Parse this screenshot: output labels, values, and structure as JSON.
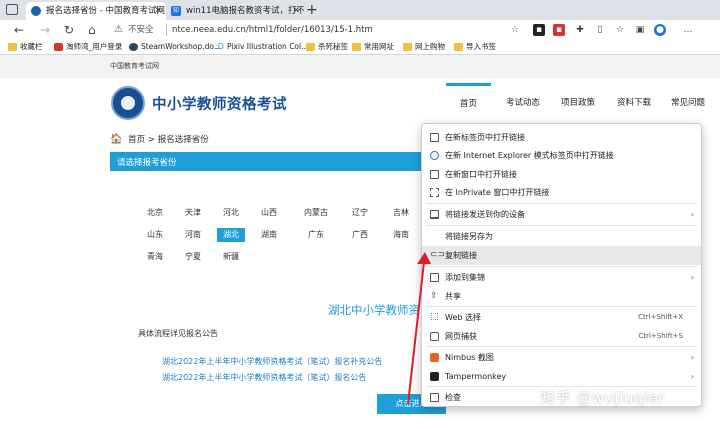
{
  "browser": {
    "tabs": [
      {
        "title": "报名选择省份 - 中国教育考试网",
        "icon": "neea-favicon",
        "active": true
      },
      {
        "title": "win11电脑报名教资考试，打不开...",
        "icon": "zhihu-favicon",
        "favicon_text": "知",
        "active": false
      }
    ],
    "new_tab": "+",
    "address": {
      "security_label": "不安全",
      "url": "ntce.neea.edu.cn/html1/folder/16013/15-1.htm"
    },
    "bookmarks": [
      {
        "label": "收藏栏",
        "icon": "folder-icon"
      },
      {
        "label": "淘师湾_用户登录",
        "icon": "red-site-icon"
      },
      {
        "label": "SteamWorkshop.do...",
        "icon": "steam-icon"
      },
      {
        "label": "Pixiv Illustration Col...",
        "icon": "pixiv-icon"
      },
      {
        "label": "杀死秘签",
        "icon": "folder-icon"
      },
      {
        "label": "常用网址",
        "icon": "folder-icon"
      },
      {
        "label": "网上购物",
        "icon": "folder-icon"
      },
      {
        "label": "导入书签",
        "icon": "folder-icon"
      }
    ]
  },
  "site": {
    "top_label": "中国教育考试网",
    "name": "中小学教师资格考试",
    "nav": [
      "首页",
      "考试动态",
      "项目政策",
      "资料下载",
      "常见问题"
    ],
    "breadcrumb": {
      "home": "首页",
      "separator": ">",
      "current": "报名选择省份"
    },
    "section_title": "请选择报考省份",
    "provinces": [
      [
        "北京",
        "天津",
        "河北",
        "山西",
        "内蒙古",
        "辽宁",
        "吉林"
      ],
      [
        "山东",
        "河南",
        "湖北",
        "湖南",
        "广东",
        "广西",
        "海南"
      ],
      [
        "青海",
        "宁夏",
        "新疆"
      ]
    ],
    "selected_province": "湖北",
    "exam_title": "湖北中小学教师资",
    "flow_label": "具体流程详见报名公告",
    "notices": [
      "湖北2022年上半年中小学教师资格考试（笔试）报名补充公告",
      "湖北2022年上半年中小学教师资格考试（笔试）报名公告"
    ],
    "apply_button": "点击进入"
  },
  "context_menu": {
    "items": [
      {
        "label": "在新标签页中打开链接",
        "icon": "new-tab-icon"
      },
      {
        "label": "在新 Internet Explorer 模式标签页中打开链接",
        "icon": "ie-icon"
      },
      {
        "label": "在新窗口中打开链接",
        "icon": "new-window-icon"
      },
      {
        "label": "在 InPrivate 窗口中打开链接",
        "icon": "inprivate-icon"
      },
      {
        "label": "将链接发送到你的设备",
        "icon": "send-device-icon",
        "submenu": true
      },
      {
        "label": "将链接另存为",
        "icon": ""
      },
      {
        "label": "复制链接",
        "icon": "link-icon",
        "highlighted": true
      },
      {
        "label": "添加到集锦",
        "icon": "collections-icon",
        "submenu": true
      },
      {
        "label": "共享",
        "icon": "share-icon"
      },
      {
        "label": "Web 选择",
        "icon": "web-select-icon",
        "shortcut": "Ctrl+Shift+X"
      },
      {
        "label": "网页捕获",
        "icon": "web-capture-icon",
        "shortcut": "Ctrl+Shift+S"
      },
      {
        "label": "Nimbus 截图",
        "icon": "nimbus-icon",
        "submenu": true
      },
      {
        "label": "Tampermonkey",
        "icon": "tampermonkey-icon",
        "submenu": true
      },
      {
        "label": "检查",
        "icon": "inspect-icon"
      }
    ]
  },
  "watermark": "知乎 @wujiuqier",
  "colors": {
    "accent": "#1e9fd8",
    "brand_blue": "#1a4f95",
    "annotation_red": "#d8202a",
    "home_icon": "#e08a1e"
  }
}
